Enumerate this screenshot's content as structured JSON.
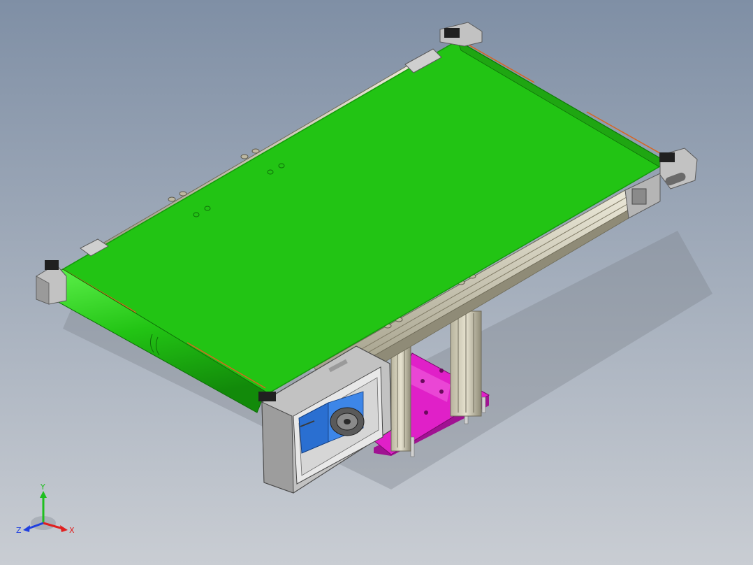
{
  "viewport": {
    "background_top": "#7f8fa5",
    "background_bottom": "#c9cdd3"
  },
  "model": {
    "belt_color": "#22c414",
    "belt_edge_color": "#149a0b",
    "frame_color": "#c2c2c2",
    "rail_color": "#d8d4bf",
    "mount_plate_color": "#e020c8",
    "motor_color": "#2a6fd1"
  },
  "triad": {
    "x_label": "X",
    "y_label": "Y",
    "z_label": "Z",
    "x_color": "#e02020",
    "y_color": "#1fbf1f",
    "z_color": "#2040e0"
  }
}
